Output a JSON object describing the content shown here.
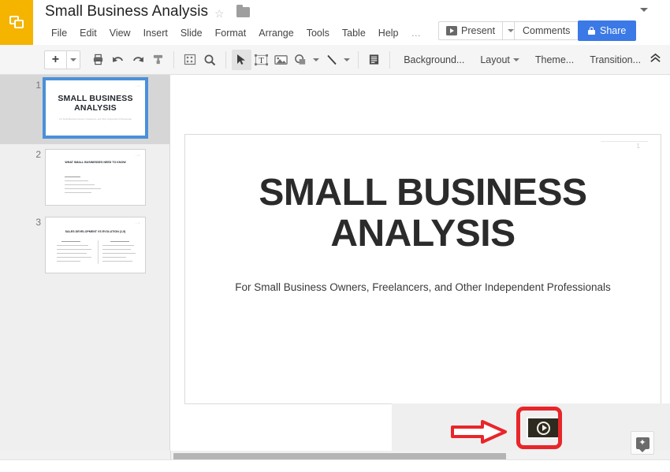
{
  "app": {
    "logo_icon": "slides-logo-icon",
    "accent_yellow": "#f4b400",
    "accent_blue": "#3b79e6",
    "highlight_red": "#e8262a"
  },
  "header": {
    "doc_title": "Small Business Analysis",
    "star_icon": "☆",
    "folder_icon": "folder-icon",
    "menu_items": [
      {
        "label": "File"
      },
      {
        "label": "Edit"
      },
      {
        "label": "View"
      },
      {
        "label": "Insert"
      },
      {
        "label": "Slide"
      },
      {
        "label": "Format"
      },
      {
        "label": "Arrange"
      },
      {
        "label": "Tools"
      },
      {
        "label": "Table"
      },
      {
        "label": "Help"
      }
    ],
    "menu_more": "…",
    "present_label": "Present",
    "comments_label": "Comments",
    "share_label": "Share"
  },
  "toolbar": {
    "new_slide_plus": "+",
    "print_icon": "print-icon",
    "undo_icon": "undo-icon",
    "redo_icon": "redo-icon",
    "paint_format_icon": "paint-format-icon",
    "fit_icon": "fit-to-window-icon",
    "zoom_icon": "zoom-icon",
    "select_icon": "select-cursor-icon",
    "textbox_icon": "text-box-icon",
    "image_icon": "image-icon",
    "shape_icon": "shape-icon",
    "line_icon": "line-icon",
    "layout_icon": "text-layout-icon",
    "background_label": "Background...",
    "layout_label": "Layout",
    "theme_label": "Theme...",
    "transition_label": "Transition...",
    "collapse_icon": "chevron-up-double-icon"
  },
  "filmstrip": {
    "slides": [
      {
        "number": "1",
        "title": "SMALL BUSINESS ANALYSIS",
        "subtitle": "For Small Business Owners, Freelancers, and Other Independent Professionals",
        "selected": true
      },
      {
        "number": "2",
        "title": "WHAT SMALL BUSINESSES NEED TO KNOW",
        "selected": false
      },
      {
        "number": "3",
        "title": "SALES DEVELOPMENT VS EVOLUTION (1-5)",
        "selected": false
      }
    ]
  },
  "canvas": {
    "slide_title": "SMALL BUSINESS ANALYSIS",
    "slide_subtitle": "For Small Business Owners, Freelancers, and Other Independent Professionals",
    "page_number": "1"
  },
  "bottom": {
    "play_button_icon": "video-play-thumbnail-icon",
    "arrow_icon": "red-pointer-arrow-icon",
    "explore_label": "explore-icon",
    "hscrollbar": "horizontal-scrollbar"
  }
}
